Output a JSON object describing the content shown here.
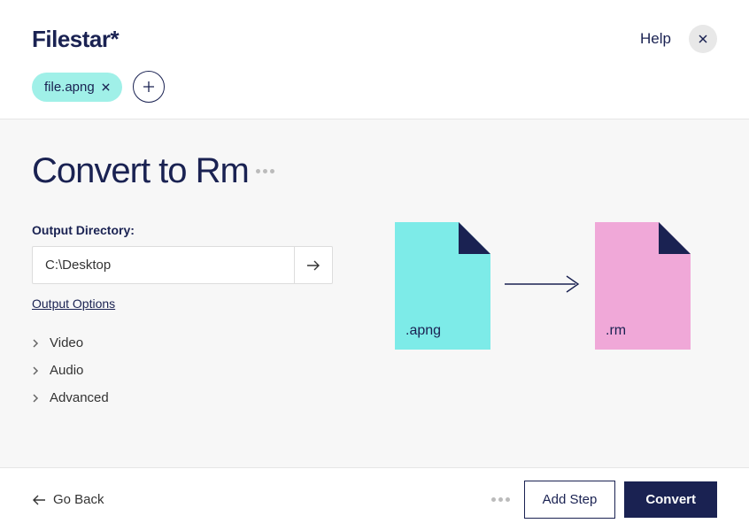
{
  "header": {
    "logo": "Filestar*",
    "help_label": "Help",
    "file_chip": "file.apng"
  },
  "main": {
    "title": "Convert to Rm",
    "output_label": "Output Directory:",
    "output_value": "C:\\Desktop",
    "output_options": "Output Options",
    "expand_items": {
      "video": "Video",
      "audio": "Audio",
      "advanced": "Advanced"
    },
    "illustration": {
      "source_ext": ".apng",
      "target_ext": ".rm"
    }
  },
  "footer": {
    "go_back": "Go Back",
    "add_step": "Add Step",
    "convert": "Convert"
  }
}
